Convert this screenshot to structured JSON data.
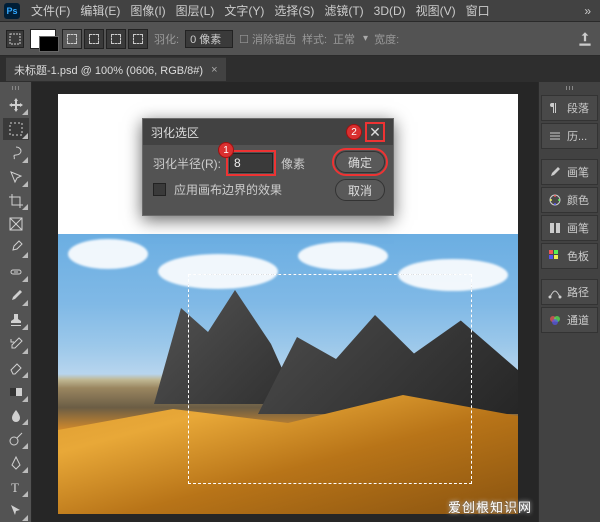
{
  "menu": {
    "items": [
      "文件(F)",
      "编辑(E)",
      "图像(I)",
      "图层(L)",
      "文字(Y)",
      "选择(S)",
      "滤镜(T)",
      "3D(D)",
      "视图(V)",
      "窗口"
    ]
  },
  "options": {
    "feather_label": "羽化:",
    "feather_value": "0 像素",
    "antialias": "消除锯齿",
    "style_label": "样式:",
    "style_value": "正常",
    "width_label": "宽度:"
  },
  "tab": {
    "title": "未标题-1.psd @ 100% (0606, RGB/8#)",
    "close": "×"
  },
  "dialog": {
    "title": "羽化选区",
    "radius_label": "羽化半径(R):",
    "radius_value": "8",
    "radius_unit": "像素",
    "apply_label": "应用画布边界的效果",
    "ok": "确定",
    "cancel": "取消",
    "badge1": "1",
    "badge2": "2"
  },
  "panels": {
    "items": [
      "段落",
      "历...",
      "画笔",
      "颜色",
      "画笔",
      "色板",
      "路径",
      "通道"
    ]
  },
  "watermark": "爱创根知识网"
}
